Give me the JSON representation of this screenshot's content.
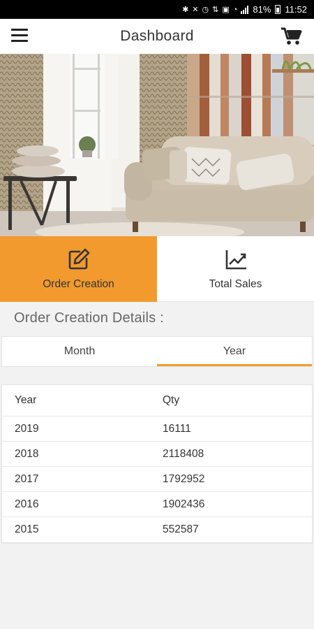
{
  "status_bar": {
    "battery": "81%",
    "time": "11:52"
  },
  "header": {
    "title": "Dashboard"
  },
  "feature_tabs": [
    {
      "label": "Order Creation",
      "icon": "edit-icon",
      "active": true
    },
    {
      "label": "Total Sales",
      "icon": "trending-up-chart-icon",
      "active": false
    }
  ],
  "section": {
    "title": "Order Creation Details :"
  },
  "period_tabs": [
    {
      "label": "Month",
      "selected": false
    },
    {
      "label": "Year",
      "selected": true
    }
  ],
  "table": {
    "headers": [
      "Year",
      "Qty"
    ],
    "rows": [
      [
        "2019",
        "16111"
      ],
      [
        "2018",
        "2118408"
      ],
      [
        "2017",
        "1792952"
      ],
      [
        "2016",
        "1902436"
      ],
      [
        "2015",
        "552587"
      ]
    ]
  },
  "colors": {
    "accent": "#f29a2e",
    "background": "#f2f2f2"
  }
}
